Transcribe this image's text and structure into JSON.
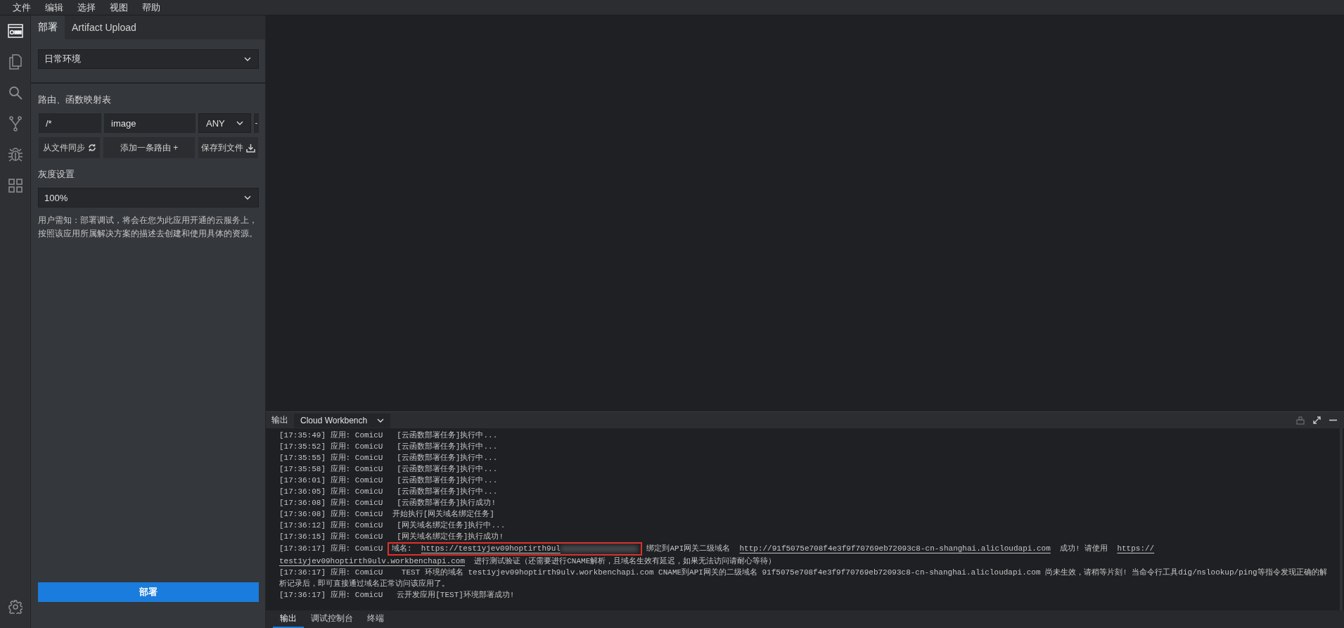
{
  "menu": [
    {
      "label": "文件"
    },
    {
      "label": "编辑"
    },
    {
      "label": "选择"
    },
    {
      "label": "视图"
    },
    {
      "label": "帮助"
    }
  ],
  "activity_bar": {
    "items": [
      {
        "kind": "deploy",
        "selected": true
      },
      {
        "kind": "files",
        "selected": false
      },
      {
        "kind": "search",
        "selected": false
      },
      {
        "kind": "branch",
        "selected": false
      },
      {
        "kind": "bug",
        "selected": false
      },
      {
        "kind": "grid",
        "selected": false
      }
    ],
    "footer": {
      "kind": "settings"
    }
  },
  "sidebar": {
    "tabs": [
      {
        "label": "部署",
        "selected": true
      },
      {
        "label": "Artifact Upload",
        "selected": false
      }
    ],
    "environment_select": {
      "value": "日常环境"
    },
    "route_table": {
      "title": "路由、函数映射表",
      "rows": [
        {
          "path": "/*",
          "function": "image",
          "method": "ANY",
          "remove": "-"
        }
      ],
      "buttons": [
        {
          "label": "从文件同步",
          "kind": "sync"
        },
        {
          "label": "添加一条路由 +",
          "kind": "plain"
        },
        {
          "label": "保存到文件",
          "kind": "download"
        }
      ]
    },
    "gray_release": {
      "title": "灰度设置",
      "value": "100%"
    },
    "notice": "用户需知：部署调试，将会在您为此应用开通的云服务上，按照该应用所属解决方案的描述去创建和使用具体的资源。",
    "deploy_button": "部署"
  },
  "panel": {
    "label": "输出",
    "channel": "Cloud Workbench",
    "log": [
      {
        "prefix": "[17:35:49] 应用: ComicU",
        "parts": [
          {
            "kind": "text",
            "text": "  [云函数部署任务]执行中..."
          }
        ]
      },
      {
        "prefix": "[17:35:52] 应用: ComicU",
        "parts": [
          {
            "kind": "text",
            "text": "  [云函数部署任务]执行中..."
          }
        ]
      },
      {
        "prefix": "[17:35:55] 应用: ComicU",
        "parts": [
          {
            "kind": "text",
            "text": "  [云函数部署任务]执行中..."
          }
        ]
      },
      {
        "prefix": "[17:35:58] 应用: ComicU",
        "parts": [
          {
            "kind": "text",
            "text": "  [云函数部署任务]执行中..."
          }
        ]
      },
      {
        "prefix": "[17:36:01] 应用: ComicU",
        "parts": [
          {
            "kind": "text",
            "text": "  [云函数部署任务]执行中..."
          }
        ]
      },
      {
        "prefix": "[17:36:05] 应用: ComicU",
        "parts": [
          {
            "kind": "text",
            "text": "  [云函数部署任务]执行中..."
          }
        ]
      },
      {
        "prefix": "[17:36:08] 应用: ComicU",
        "parts": [
          {
            "kind": "text",
            "text": "  [云函数部署任务]执行成功!"
          }
        ]
      },
      {
        "prefix": "[17:36:08] 应用: ComicU",
        "parts": [
          {
            "kind": "text",
            "text": " 开始执行[网关域名绑定任务]"
          }
        ]
      },
      {
        "prefix": "[17:36:12] 应用: ComicU",
        "parts": [
          {
            "kind": "text",
            "text": "  [网关域名绑定任务]执行中..."
          }
        ]
      },
      {
        "prefix": "[17:36:15] 应用: ComicU",
        "parts": [
          {
            "kind": "text",
            "text": "  [网关域名绑定任务]执行成功!"
          }
        ]
      },
      {
        "prefix": "[17:36:17] 应用: ComicU",
        "parts": [
          {
            "kind": "highlight",
            "parts": [
              {
                "kind": "text",
                "text": "域名:  "
              },
              {
                "kind": "link",
                "text": "https://test1yjev09hoptirth9ul"
              },
              {
                "kind": "blur"
              }
            ]
          },
          {
            "kind": "text",
            "text": " 绑定到API网关二级域名  "
          },
          {
            "kind": "link",
            "text": "http://91f5075e708f4e3f9f70769eb72093c8-cn-shanghai.alicloudapi.com"
          },
          {
            "kind": "text",
            "text": "  成功! 请使用  "
          },
          {
            "kind": "link",
            "text": "https://"
          },
          {
            "kind": "link",
            "text": "test1yjev09hoptirth9ulv.workbenchapi.com"
          },
          {
            "kind": "text",
            "text": "  进行测试验证（还需要进行CNAME解析，且域名生效有延迟，如果无法访问请耐心等待）"
          }
        ]
      },
      {
        "prefix": "[17:36:17] 应用: ComicU",
        "parts": [
          {
            "kind": "text",
            "text": "   TEST 环境的域名 test1yjev09hoptirth9ulv.workbenchapi.com CNAME到API网关的二级域名 91f5075e708f4e3f9f70769eb72093c8-cn-shanghai.alicloudapi.com 尚未生效，请稍等片刻! 当命令行工具dig/nslookup/ping等指令发现正确的解析记录后，即可直接通过域名正常访问该应用了。"
          }
        ]
      },
      {
        "prefix": "[17:36:17] 应用: ComicU",
        "parts": [
          {
            "kind": "text",
            "text": "  云开发应用[TEST]环境部署成功!"
          }
        ]
      }
    ]
  },
  "bottom_tabs": [
    {
      "label": "输出",
      "selected": true
    },
    {
      "label": "调试控制台",
      "selected": false
    },
    {
      "label": "终端",
      "selected": false
    }
  ]
}
